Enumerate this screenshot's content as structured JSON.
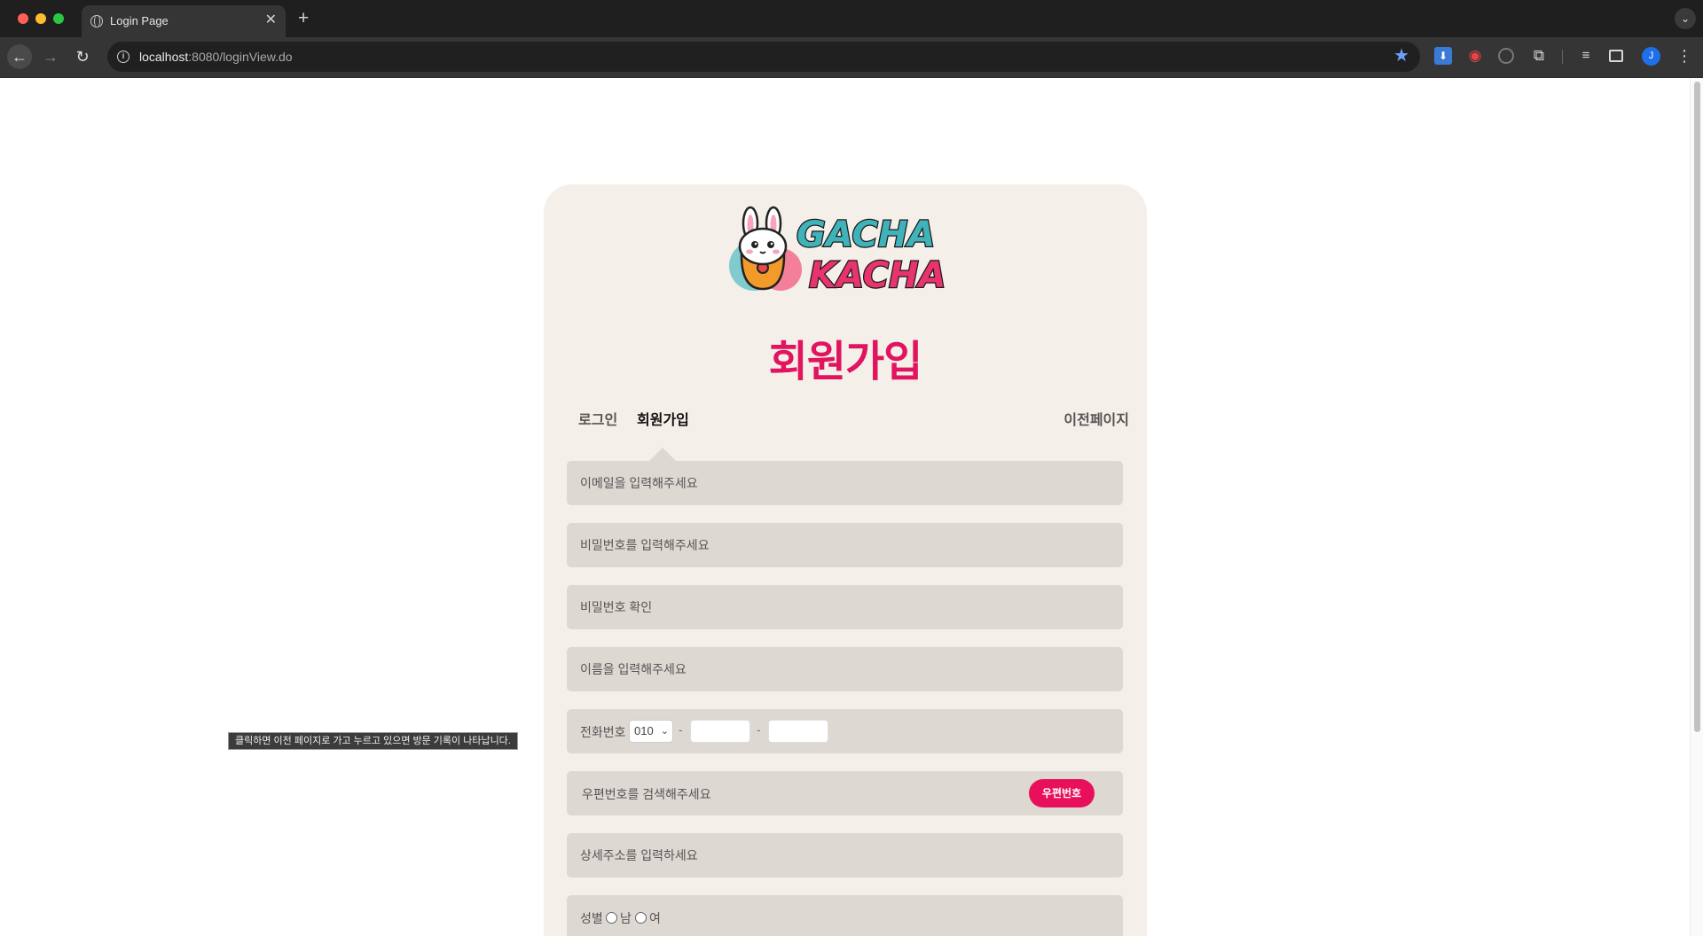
{
  "browser": {
    "tab_title": "Login Page",
    "url_host": "localhost",
    "url_path": ":8080/loginView.do",
    "profile_initial": "J"
  },
  "page": {
    "logo_text_1": "GACHA",
    "logo_text_2": "KACHA",
    "title": "회원가입",
    "tabs": {
      "login": "로그인",
      "signup": "회원가입",
      "prev_page": "이전페이지"
    },
    "fields": {
      "email_placeholder": "이메일을 입력해주세요",
      "password_placeholder": "비밀번호를 입력해주세요",
      "password_confirm_placeholder": "비밀번호 확인",
      "name_placeholder": "이름을 입력해주세요",
      "phone_label": "전화번호",
      "phone_prefix": "010",
      "phone_sep": "-",
      "zip_placeholder": "우편번호를 검색해주세요",
      "zip_button": "우편번호",
      "address_placeholder": "상세주소를 입력하세요",
      "gender_label": "성별",
      "gender_male": "남",
      "gender_female": "여"
    },
    "tooltip": "클릭하면 이전 페이지로 가고 누르고 있으면 방문 기록이 나타납니다.",
    "colors": {
      "accent": "#e8105a",
      "card": "#f5efe9",
      "field": "#ded8d3"
    }
  }
}
